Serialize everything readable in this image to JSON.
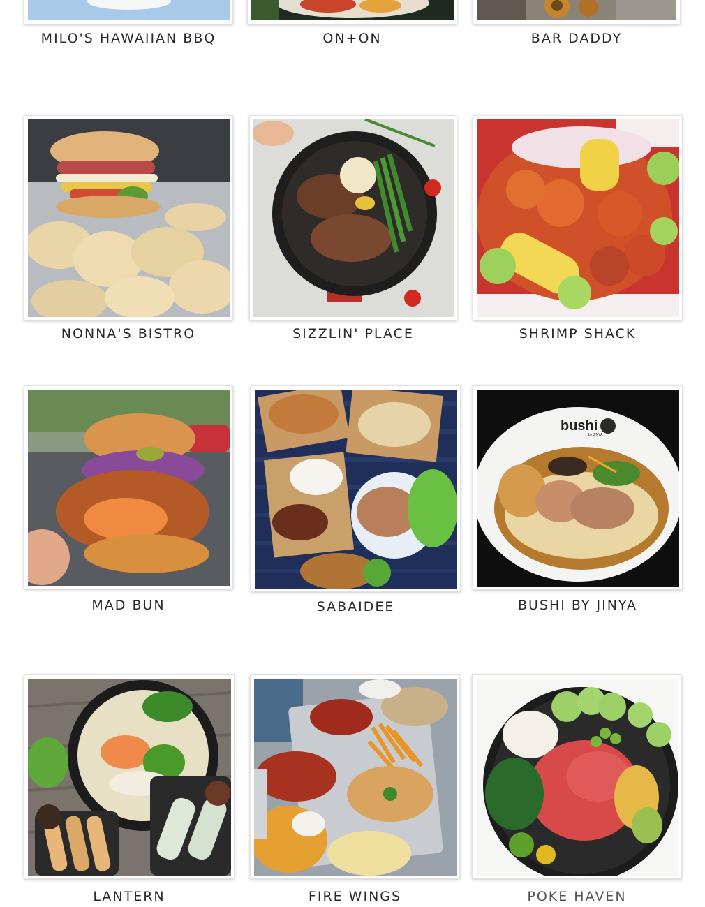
{
  "restaurants": [
    {
      "name": "MILO'S HAWAIIAN BBQ",
      "photo": "plate-lunch-photo"
    },
    {
      "name": "ON+ON",
      "photo": "korean-platter-photo"
    },
    {
      "name": "BAR DADDY",
      "photo": "onion-rings-photo"
    },
    {
      "name": "NONNA'S BISTRO",
      "photo": "sandwich-chips-photo"
    },
    {
      "name": "SIZZLIN' PLACE",
      "photo": "steak-skillet-photo"
    },
    {
      "name": "SHRIMP SHACK",
      "photo": "shrimp-boil-photo"
    },
    {
      "name": "MAD BUN",
      "photo": "fried-chicken-sandwich-photo"
    },
    {
      "name": "SABAIDEE",
      "photo": "thai-spread-photo"
    },
    {
      "name": "BUSHI BY JINYA",
      "photo": "ramen-bowl-photo"
    },
    {
      "name": "LANTERN",
      "photo": "pho-spring-rolls-photo"
    },
    {
      "name": "FIRE WINGS",
      "photo": "wings-fries-tray-photo"
    },
    {
      "name": "POKE HAVEN",
      "photo": "poke-bowl-photo"
    }
  ],
  "bowl_logo_text": "bushi",
  "bowl_logo_sub": "by JINYA",
  "label_color": "#2a2a2a",
  "last_label_color": "#555555"
}
